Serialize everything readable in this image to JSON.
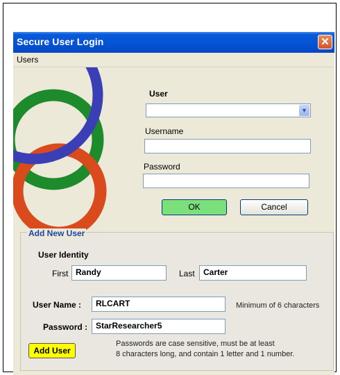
{
  "window": {
    "title": "Secure User Login",
    "close_glyph": "✕"
  },
  "menu": {
    "users": "Users"
  },
  "login": {
    "user_label": "User",
    "user_value": "",
    "username_label": "Username",
    "username_value": "",
    "password_label": "Password",
    "password_value": "",
    "ok_label": "OK",
    "cancel_label": "Cancel"
  },
  "add_user": {
    "group_title": "Add New User",
    "identity_label": "User Identity",
    "first_label": "First",
    "first_value": "Randy",
    "last_label": "Last",
    "last_value": "Carter",
    "username_label": "User Name :",
    "username_value": "RLCART",
    "username_hint": "Minimum of 6 characters",
    "password_label": "Password :",
    "password_value": "StarResearcher5",
    "button_label": "Add User",
    "password_hint_1": "Passwords are case sensitive, must be at least",
    "password_hint_2": "8 characters long, and contain 1 letter and 1 number."
  },
  "colors": {
    "titlebar": "#0554d6",
    "ok_button": "#7be07b",
    "add_user_button": "#ffff00",
    "group_title": "#1a45a6"
  }
}
